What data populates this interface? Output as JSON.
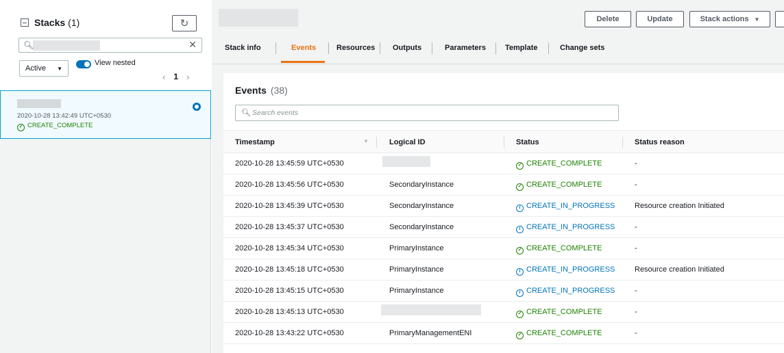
{
  "sidebar": {
    "title": "Stacks",
    "count": "(1)",
    "filter": {
      "selected": "Active"
    },
    "view_nested_label": "View nested",
    "view_nested_on": true,
    "pager": {
      "prev": "‹",
      "page": "1",
      "next": "›"
    },
    "stack": {
      "date": "2020-10-28 13:42:49 UTC+0530",
      "status": "CREATE_COMPLETE"
    }
  },
  "header": {
    "buttons": {
      "delete": "Delete",
      "update": "Update",
      "stack_actions": "Stack actions"
    }
  },
  "tabs": [
    "Stack info",
    "Events",
    "Resources",
    "Outputs",
    "Parameters",
    "Template",
    "Change sets"
  ],
  "active_tab": "Events",
  "events": {
    "title": "Events",
    "count": "(38)",
    "search_placeholder": "Search events",
    "columns": [
      "Timestamp",
      "Logical ID",
      "Status",
      "Status reason"
    ],
    "rows": [
      {
        "timestamp": "2020-10-28 13:45:59 UTC+0530",
        "logical_id": "",
        "status": "CREATE_COMPLETE",
        "reason": "-"
      },
      {
        "timestamp": "2020-10-28 13:45:56 UTC+0530",
        "logical_id": "SecondaryInstance",
        "status": "CREATE_COMPLETE",
        "reason": "-"
      },
      {
        "timestamp": "2020-10-28 13:45:39 UTC+0530",
        "logical_id": "SecondaryInstance",
        "status": "CREATE_IN_PROGRESS",
        "reason": "Resource creation Initiated"
      },
      {
        "timestamp": "2020-10-28 13:45:37 UTC+0530",
        "logical_id": "SecondaryInstance",
        "status": "CREATE_IN_PROGRESS",
        "reason": "-"
      },
      {
        "timestamp": "2020-10-28 13:45:34 UTC+0530",
        "logical_id": "PrimaryInstance",
        "status": "CREATE_COMPLETE",
        "reason": "-"
      },
      {
        "timestamp": "2020-10-28 13:45:18 UTC+0530",
        "logical_id": "PrimaryInstance",
        "status": "CREATE_IN_PROGRESS",
        "reason": "Resource creation Initiated"
      },
      {
        "timestamp": "2020-10-28 13:45:15 UTC+0530",
        "logical_id": "PrimaryInstance",
        "status": "CREATE_IN_PROGRESS",
        "reason": "-"
      },
      {
        "timestamp": "2020-10-28 13:45:13 UTC+0530",
        "logical_id": "",
        "status": "CREATE_COMPLETE",
        "reason": "-"
      },
      {
        "timestamp": "2020-10-28 13:43:22 UTC+0530",
        "logical_id": "PrimaryManagementENI",
        "status": "CREATE_COMPLETE",
        "reason": "-"
      }
    ]
  },
  "colors": {
    "complete": "#1d8102",
    "in_progress": "#0073bb",
    "accent": "#ec7211"
  }
}
